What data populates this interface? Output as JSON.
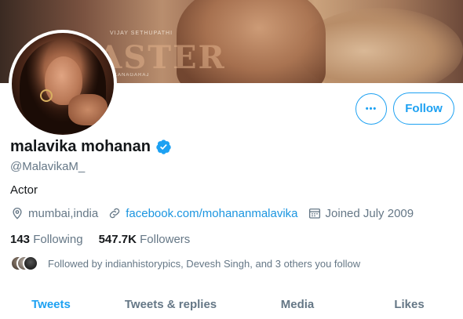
{
  "banner": {
    "title_art": "MASTER",
    "credit_top": "VIJAY SETHUPATHI",
    "credit_bottom": "KANAGARAJ"
  },
  "profile": {
    "name": "malavika mohanan",
    "handle": "@MalavikaM_",
    "bio": "Actor",
    "location": "mumbai,india",
    "website": "facebook.com/mohananmalavika",
    "joined": "Joined July 2009",
    "verified": true
  },
  "actions": {
    "more_label": "•••",
    "follow_label": "Follow"
  },
  "counts": {
    "following_value": "143",
    "following_label": "Following",
    "followers_value": "547.7K",
    "followers_label": "Followers"
  },
  "followed_by": {
    "text": "Followed by indianhistorypics, Devesh Singh, and 3 others you follow"
  },
  "tabs": [
    {
      "label": "Tweets",
      "active": true
    },
    {
      "label": "Tweets & replies",
      "active": false
    },
    {
      "label": "Media",
      "active": false
    },
    {
      "label": "Likes",
      "active": false
    }
  ],
  "colors": {
    "accent": "#1da1f2",
    "link": "#1b95e0",
    "secondary_text": "#657786",
    "primary_text": "#14171a"
  }
}
